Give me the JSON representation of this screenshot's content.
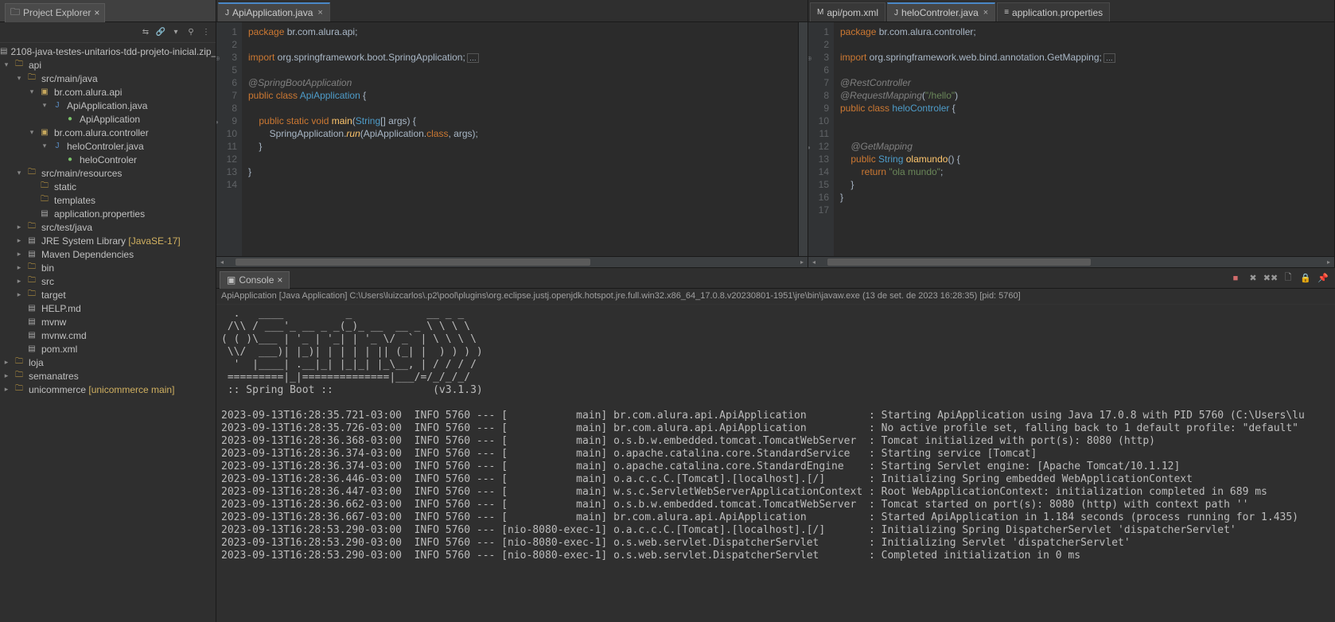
{
  "explorer": {
    "title": "Project Explorer",
    "tree": [
      {
        "d": 0,
        "a": "none",
        "ico": "file",
        "lbl": "2108-java-testes-unitarios-tdd-projeto-inicial.zip_"
      },
      {
        "d": 0,
        "a": "open",
        "ico": "proj",
        "lbl": "api"
      },
      {
        "d": 1,
        "a": "open",
        "ico": "folder",
        "lbl": "src/main/java"
      },
      {
        "d": 2,
        "a": "open",
        "ico": "package",
        "lbl": "br.com.alura.api"
      },
      {
        "d": 3,
        "a": "open",
        "ico": "java",
        "lbl": "ApiApplication.java"
      },
      {
        "d": 4,
        "a": "none",
        "ico": "run",
        "lbl": "ApiApplication"
      },
      {
        "d": 2,
        "a": "open",
        "ico": "package",
        "lbl": "br.com.alura.controller"
      },
      {
        "d": 3,
        "a": "open",
        "ico": "java",
        "lbl": "heloControler.java"
      },
      {
        "d": 4,
        "a": "none",
        "ico": "run",
        "lbl": "heloControler"
      },
      {
        "d": 1,
        "a": "open",
        "ico": "folder",
        "lbl": "src/main/resources"
      },
      {
        "d": 2,
        "a": "none",
        "ico": "folder",
        "lbl": "static"
      },
      {
        "d": 2,
        "a": "none",
        "ico": "folder",
        "lbl": "templates"
      },
      {
        "d": 2,
        "a": "none",
        "ico": "file",
        "lbl": "application.properties"
      },
      {
        "d": 1,
        "a": "closed",
        "ico": "folder",
        "lbl": "src/test/java"
      },
      {
        "d": 1,
        "a": "closed",
        "ico": "file",
        "lbl": "JRE System Library",
        "suffix": " [JavaSE-17]"
      },
      {
        "d": 1,
        "a": "closed",
        "ico": "file",
        "lbl": "Maven Dependencies"
      },
      {
        "d": 1,
        "a": "closed",
        "ico": "folder",
        "lbl": "bin"
      },
      {
        "d": 1,
        "a": "closed",
        "ico": "folder",
        "lbl": "src"
      },
      {
        "d": 1,
        "a": "closed",
        "ico": "folder",
        "lbl": "target"
      },
      {
        "d": 1,
        "a": "none",
        "ico": "file",
        "lbl": "HELP.md"
      },
      {
        "d": 1,
        "a": "none",
        "ico": "file",
        "lbl": "mvnw"
      },
      {
        "d": 1,
        "a": "none",
        "ico": "file",
        "lbl": "mvnw.cmd"
      },
      {
        "d": 1,
        "a": "none",
        "ico": "file",
        "lbl": "pom.xml"
      },
      {
        "d": 0,
        "a": "closed",
        "ico": "proj",
        "lbl": "loja"
      },
      {
        "d": 0,
        "a": "closed",
        "ico": "proj",
        "lbl": "semanatres"
      },
      {
        "d": 0,
        "a": "closed",
        "ico": "proj",
        "lbl": "unicommerce",
        "suffix": " [unicommerce main]"
      }
    ]
  },
  "editorLeft": {
    "tabs": [
      {
        "label": "ApiApplication.java",
        "active": true,
        "ico": "J"
      }
    ],
    "lines": [
      {
        "n": "1",
        "h": "<span class='kw'>package</span> br.com.alura.api;"
      },
      {
        "n": "2",
        "h": ""
      },
      {
        "n": "3",
        "mark": "⊕",
        "h": "<span class='imp'>import</span> org.springframework.boot.SpringApplication;<span style='border:1px solid #555;padding:0 2px;margin-left:2px;font-size:9px;'>…</span>"
      },
      {
        "n": "5",
        "h": ""
      },
      {
        "n": "6",
        "h": "<span class='ann'>@SpringBootApplication</span>"
      },
      {
        "n": "7",
        "h": "<span class='kw'>public</span> <span class='kw'>class</span> <span class='defname'>ApiApplication</span> {"
      },
      {
        "n": "8",
        "h": ""
      },
      {
        "n": "9",
        "mark": "●",
        "h": "    <span class='kw'>public</span> <span class='kw'>static</span> <span class='kw'>void</span> <span class='meth'>main</span>(<span class='defname'>String</span>[] args) {"
      },
      {
        "n": "10",
        "h": "        SpringApplication.<span class='meth' style='font-style:italic'>run</span>(ApiApplication.<span class='kw'>class</span>, args);"
      },
      {
        "n": "11",
        "h": "    }"
      },
      {
        "n": "12",
        "h": ""
      },
      {
        "n": "13",
        "h": "}"
      },
      {
        "n": "14",
        "h": ""
      }
    ]
  },
  "editorRight": {
    "tabs": [
      {
        "label": "api/pom.xml",
        "active": false,
        "ico": "M"
      },
      {
        "label": "heloControler.java",
        "active": true,
        "ico": "J"
      },
      {
        "label": "application.properties",
        "active": false,
        "ico": "≡"
      }
    ],
    "lines": [
      {
        "n": "1",
        "h": "<span class='kw'>package</span> br.com.alura.controller;"
      },
      {
        "n": "2",
        "h": ""
      },
      {
        "n": "3",
        "mark": "⊕",
        "h": "<span class='imp'>import</span> org.springframework.web.bind.annotation.GetMapping;<span style='border:1px solid #555;padding:0 2px;margin-left:2px;font-size:9px;'>…</span>"
      },
      {
        "n": "6",
        "h": ""
      },
      {
        "n": "7",
        "h": "<span class='ann'>@RestController</span>"
      },
      {
        "n": "8",
        "h": "<span class='ann'>@RequestMapping</span>(<span class='str'>\"/hello\"</span>)"
      },
      {
        "n": "9",
        "h": "<span class='kw'>public</span> <span class='kw'>class</span> <span class='defname'>heloControler</span> {"
      },
      {
        "n": "10",
        "h": ""
      },
      {
        "n": "11",
        "h": "    "
      },
      {
        "n": "12",
        "mark": "●",
        "h": "    <span class='ann'>@GetMapping</span>"
      },
      {
        "n": "13",
        "h": "    <span class='kw'>public</span> <span class='defname'>String</span> <span class='meth'>olamundo</span>() {"
      },
      {
        "n": "14",
        "h": "        <span class='kw'>return</span> <span class='str'>\"ola mundo\"</span>;"
      },
      {
        "n": "15",
        "h": "    }"
      },
      {
        "n": "16",
        "h": "}"
      },
      {
        "n": "17",
        "h": ""
      }
    ]
  },
  "console": {
    "title": "Console",
    "sub": "ApiApplication [Java Application] C:\\Users\\luizcarlos\\.p2\\pool\\plugins\\org.eclipse.justj.openjdk.hotspot.jre.full.win32.x86_64_17.0.8.v20230801-1951\\jre\\bin\\javaw.exe (13 de set. de 2023 16:28:35) [pid: 5760]",
    "ascii": "  .   ____          _            __ _ _\n /\\\\ / ___'_ __ _ _(_)_ __  __ _ \\ \\ \\ \\\n( ( )\\___ | '_ | '_| | '_ \\/ _` | \\ \\ \\ \\\n \\\\/  ___)| |_)| | | | | || (_| |  ) ) ) )\n  '  |____| .__|_| |_|_| |_\\__, | / / / /\n =========|_|==============|___/=/_/_/_/\n :: Spring Boot ::                (v3.1.3)\n",
    "log": [
      "2023-09-13T16:28:35.721-03:00  INFO 5760 --- [           main] br.com.alura.api.ApiApplication          : Starting ApiApplication using Java 17.0.8 with PID 5760 (C:\\Users\\lu",
      "2023-09-13T16:28:35.726-03:00  INFO 5760 --- [           main] br.com.alura.api.ApiApplication          : No active profile set, falling back to 1 default profile: \"default\"",
      "2023-09-13T16:28:36.368-03:00  INFO 5760 --- [           main] o.s.b.w.embedded.tomcat.TomcatWebServer  : Tomcat initialized with port(s): 8080 (http)",
      "2023-09-13T16:28:36.374-03:00  INFO 5760 --- [           main] o.apache.catalina.core.StandardService   : Starting service [Tomcat]",
      "2023-09-13T16:28:36.374-03:00  INFO 5760 --- [           main] o.apache.catalina.core.StandardEngine    : Starting Servlet engine: [Apache Tomcat/10.1.12]",
      "2023-09-13T16:28:36.446-03:00  INFO 5760 --- [           main] o.a.c.c.C.[Tomcat].[localhost].[/]       : Initializing Spring embedded WebApplicationContext",
      "2023-09-13T16:28:36.447-03:00  INFO 5760 --- [           main] w.s.c.ServletWebServerApplicationContext : Root WebApplicationContext: initialization completed in 689 ms",
      "2023-09-13T16:28:36.662-03:00  INFO 5760 --- [           main] o.s.b.w.embedded.tomcat.TomcatWebServer  : Tomcat started on port(s): 8080 (http) with context path ''",
      "2023-09-13T16:28:36.667-03:00  INFO 5760 --- [           main] br.com.alura.api.ApiApplication          : Started ApiApplication in 1.184 seconds (process running for 1.435)",
      "2023-09-13T16:28:53.290-03:00  INFO 5760 --- [nio-8080-exec-1] o.a.c.c.C.[Tomcat].[localhost].[/]       : Initializing Spring DispatcherServlet 'dispatcherServlet'",
      "2023-09-13T16:28:53.290-03:00  INFO 5760 --- [nio-8080-exec-1] o.s.web.servlet.DispatcherServlet        : Initializing Servlet 'dispatcherServlet'",
      "2023-09-13T16:28:53.290-03:00  INFO 5760 --- [nio-8080-exec-1] o.s.web.servlet.DispatcherServlet        : Completed initialization in 0 ms"
    ]
  }
}
